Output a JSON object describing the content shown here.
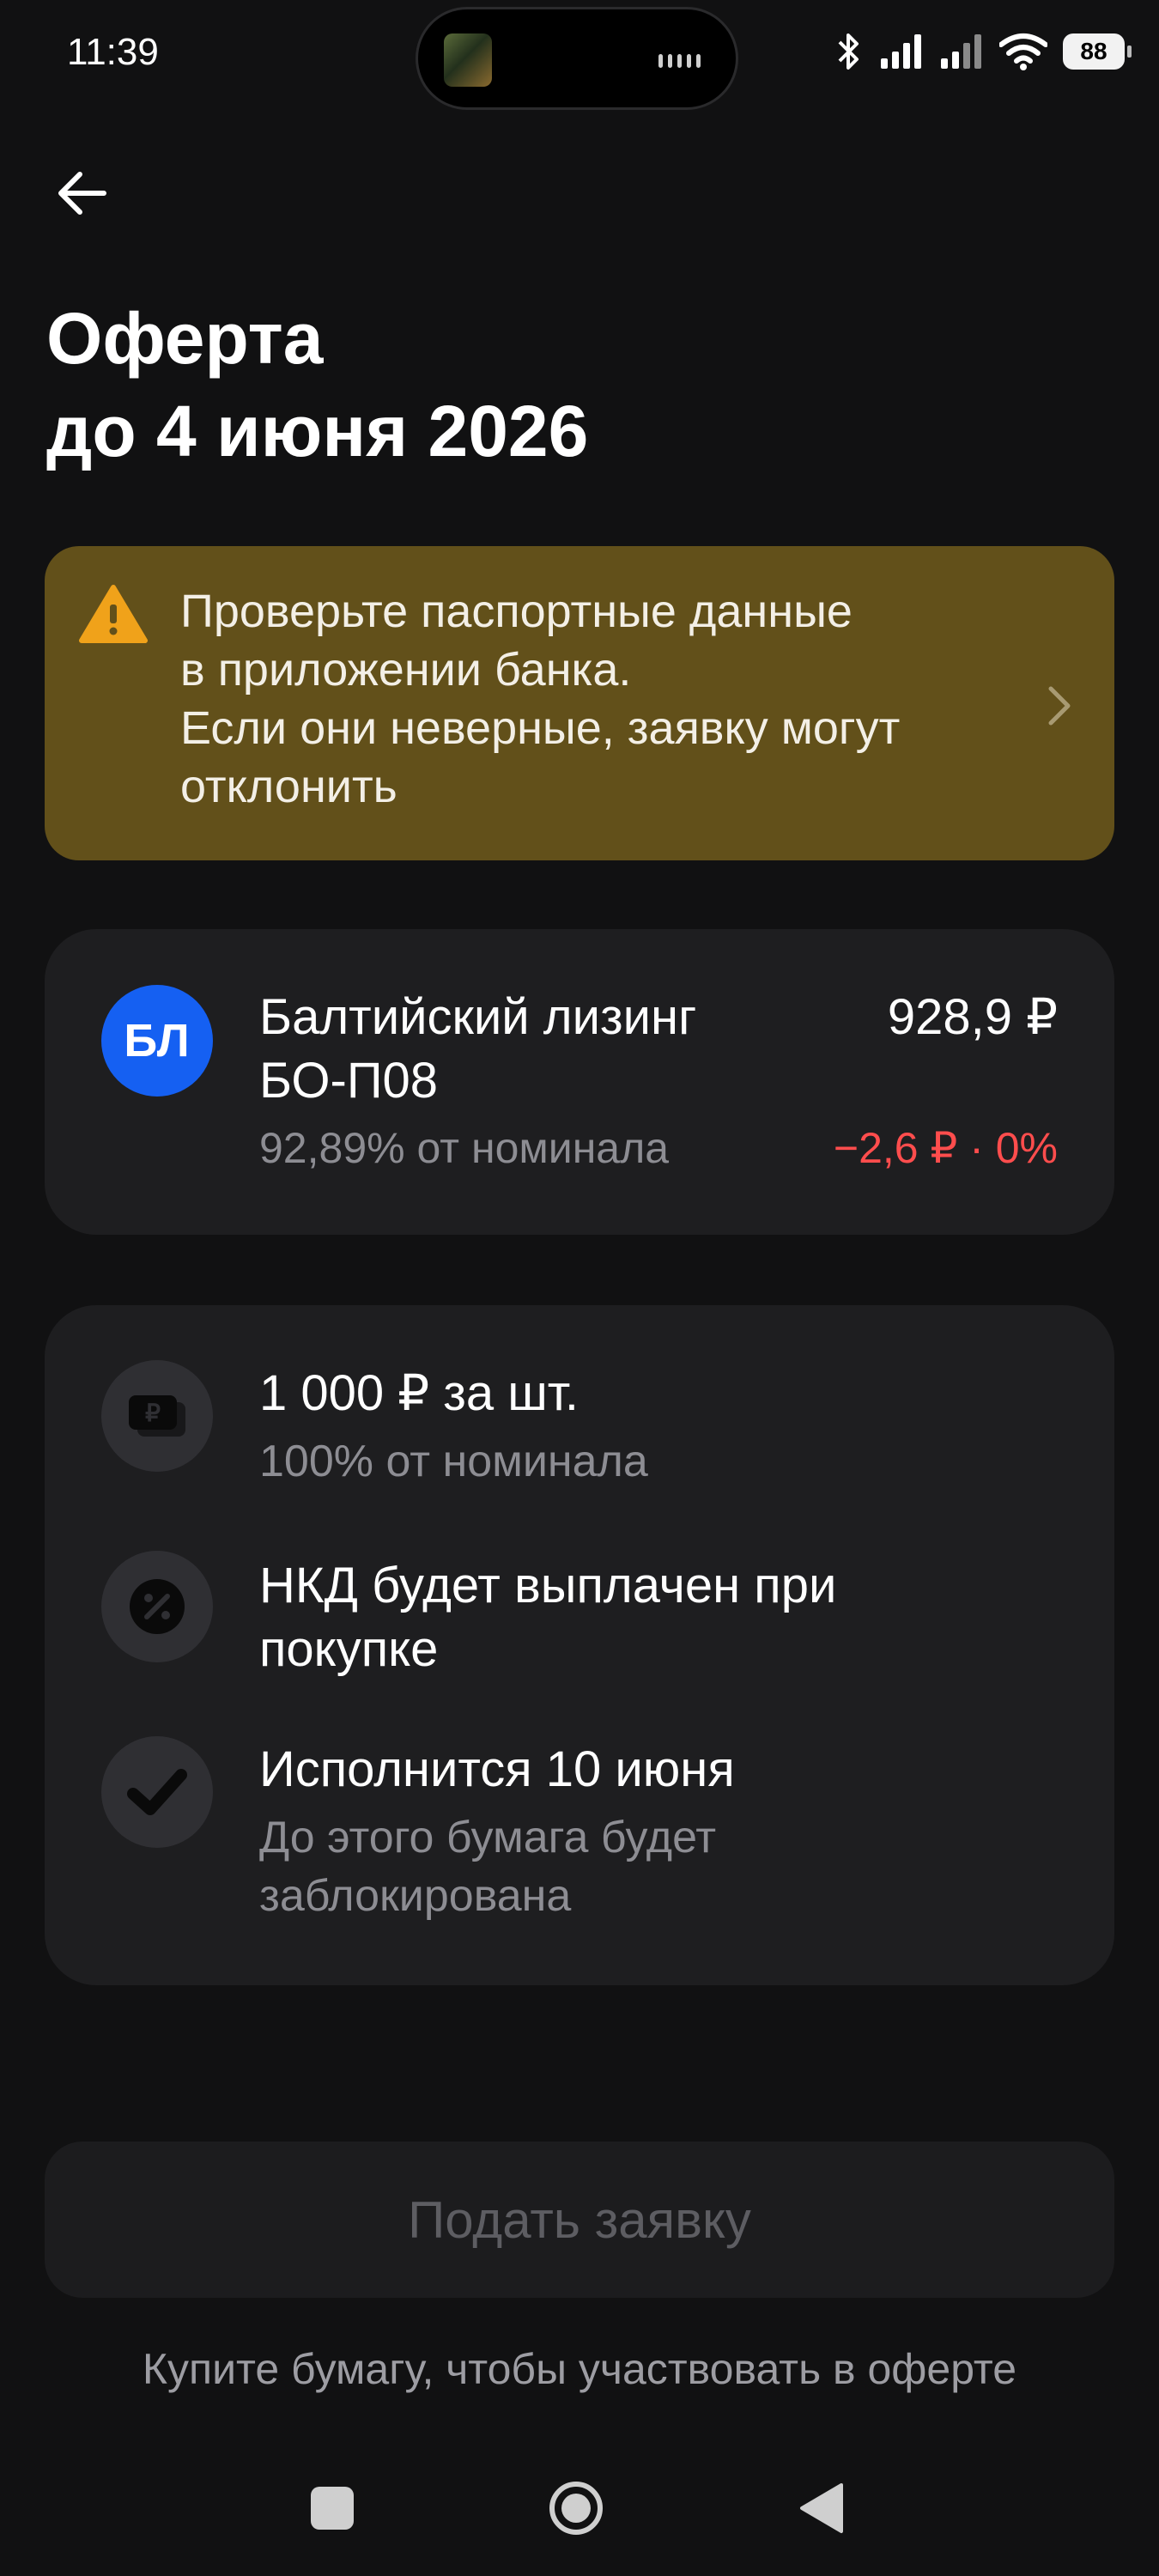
{
  "status_bar": {
    "time": "11:39",
    "battery": "88",
    "icons": [
      "bluetooth-icon",
      "signal-icon",
      "signal-icon",
      "wifi-icon",
      "battery-icon"
    ]
  },
  "header": {
    "title_line1": "Оферта",
    "title_line2": "до 4 июня 2026"
  },
  "warning": {
    "lines": [
      "Проверьте паспортные данные",
      "в приложении банка.",
      "Если они неверные, заявку могут",
      "отклонить"
    ],
    "accent_color": "#62501a",
    "icon_color": "#f0a21a"
  },
  "bond": {
    "logo_text": "БЛ",
    "logo_color": "#1560f2",
    "name_line1": "Балтийский лизинг",
    "name_line2": "БО-П08",
    "price": "928,9 ₽",
    "nominal": "92,89% от номинала",
    "change": "−2,6 ₽ · 0%",
    "change_color": "#ff4d4d"
  },
  "details": {
    "items": [
      {
        "icon": "ruble-bill-icon",
        "title": "1 000 ₽ за шт.",
        "subtitle": "100% от номинала"
      },
      {
        "icon": "percent-icon",
        "title_line1": "НКД будет выплачен при",
        "title_line2": "покупке"
      },
      {
        "icon": "checkmark-icon",
        "title": "Исполнится 10 июня",
        "subtitle_line1": "До этого бумага будет",
        "subtitle_line2": "заблокирована"
      }
    ]
  },
  "actions": {
    "submit_label": "Подать заявку",
    "hint": "Купите бумагу, чтобы участвовать в оферте"
  }
}
